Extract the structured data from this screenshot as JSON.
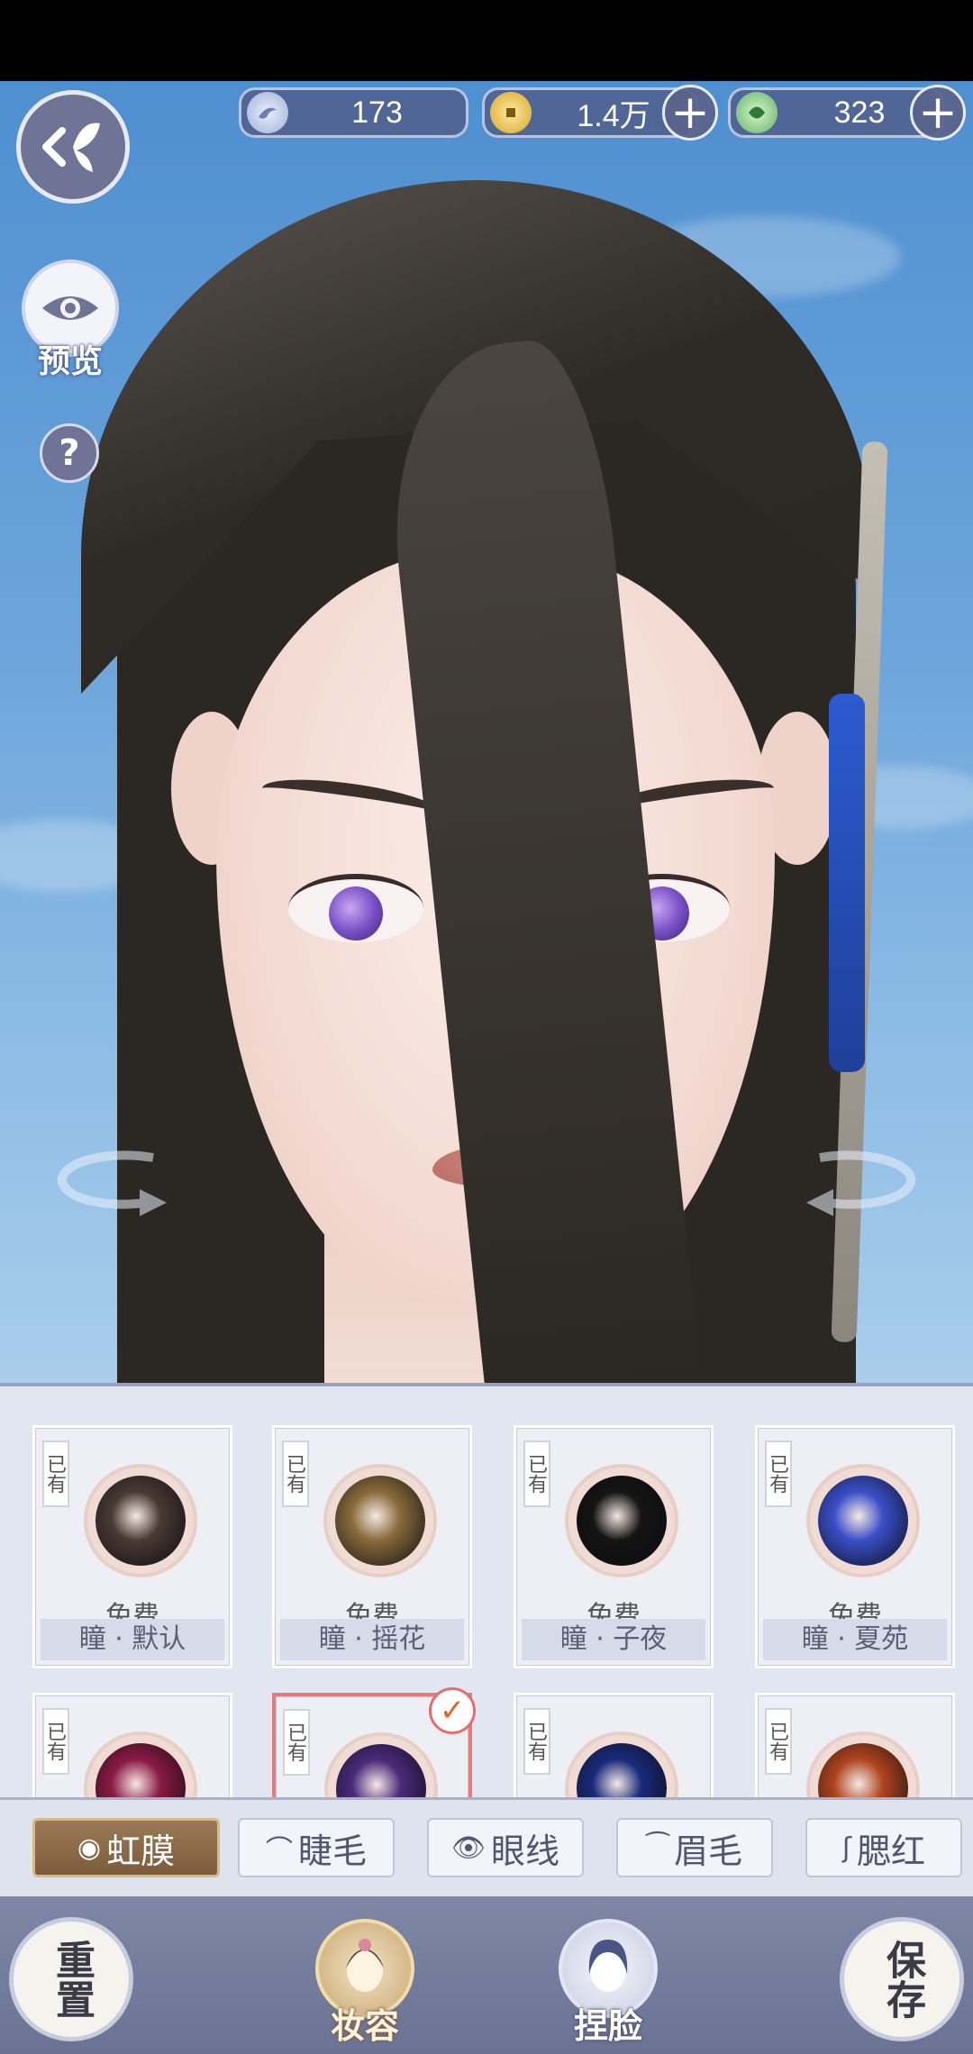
{
  "currency": {
    "jade": "173",
    "coins": "1.4万",
    "spirit": "323"
  },
  "left_controls": {
    "preview_label": "预览",
    "help_symbol": "?"
  },
  "iris_grid": {
    "owned_tag": "已有",
    "cards": [
      {
        "price": "免费",
        "name": "瞳 · 默认",
        "color": "#4a3a34"
      },
      {
        "price": "免费",
        "name": "瞳 · 摇花",
        "color": "#8a6a3a"
      },
      {
        "price": "免费",
        "name": "瞳 · 子夜",
        "color": "#141414"
      },
      {
        "price": "免费",
        "name": "瞳 · 夏苑",
        "color": "#3a4fc8"
      },
      {
        "price": "",
        "name": "",
        "color": "#8a1a44"
      },
      {
        "price": "",
        "name": "",
        "color": "#4a2a7a",
        "selected": true
      },
      {
        "price": "",
        "name": "",
        "color": "#1a2a7a"
      },
      {
        "price": "",
        "name": "",
        "color": "#b0441e"
      }
    ]
  },
  "tabs": [
    {
      "label": "虹膜",
      "icon": "iris-icon",
      "active": true
    },
    {
      "label": "睫毛",
      "icon": "eyelash-icon",
      "active": false
    },
    {
      "label": "眼线",
      "icon": "eyeliner-icon",
      "active": false
    },
    {
      "label": "眉毛",
      "icon": "eyebrow-icon",
      "active": false
    },
    {
      "label": "腮红",
      "icon": "blush-icon",
      "active": false
    }
  ],
  "bottom": {
    "reset": "重置",
    "makeup": "妆容",
    "face": "捏脸",
    "save": "保存"
  },
  "colors": {
    "accent_gold": "#8a6a48",
    "selected_border": "#e77b7b"
  }
}
